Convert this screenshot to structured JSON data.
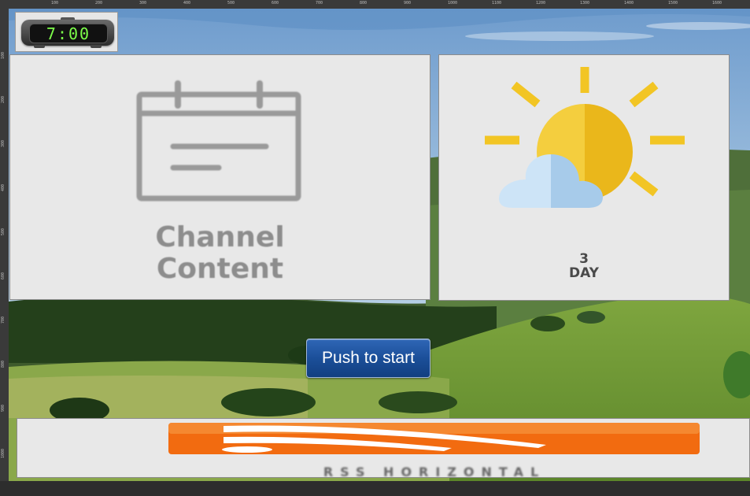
{
  "ruler": {
    "top_ticks": [
      "100",
      "200",
      "300",
      "400",
      "500",
      "600",
      "700",
      "800",
      "900",
      "1000",
      "1100",
      "1200",
      "1300",
      "1400",
      "1500",
      "1600"
    ],
    "left_ticks": [
      "100",
      "200",
      "300",
      "400",
      "500",
      "600",
      "700",
      "800",
      "900",
      "1000"
    ]
  },
  "clock": {
    "time": "7:00"
  },
  "channel": {
    "line1": "Channel",
    "line2": "Content"
  },
  "weather": {
    "line1": "3",
    "line2": "DAY"
  },
  "start_button": {
    "label": "Push to start"
  },
  "rss": {
    "label": "RSS HORIZONTAL"
  },
  "colors": {
    "sun": "#f2c200",
    "cloud": "#a9cdea",
    "rss_orange": "#f26b10",
    "button_blue": "#1b4f99",
    "panel_bg": "#e8e8e8"
  },
  "icons": [
    "calendar-icon",
    "sun-cloud-icon",
    "rss-icon",
    "alarm-clock-icon"
  ]
}
